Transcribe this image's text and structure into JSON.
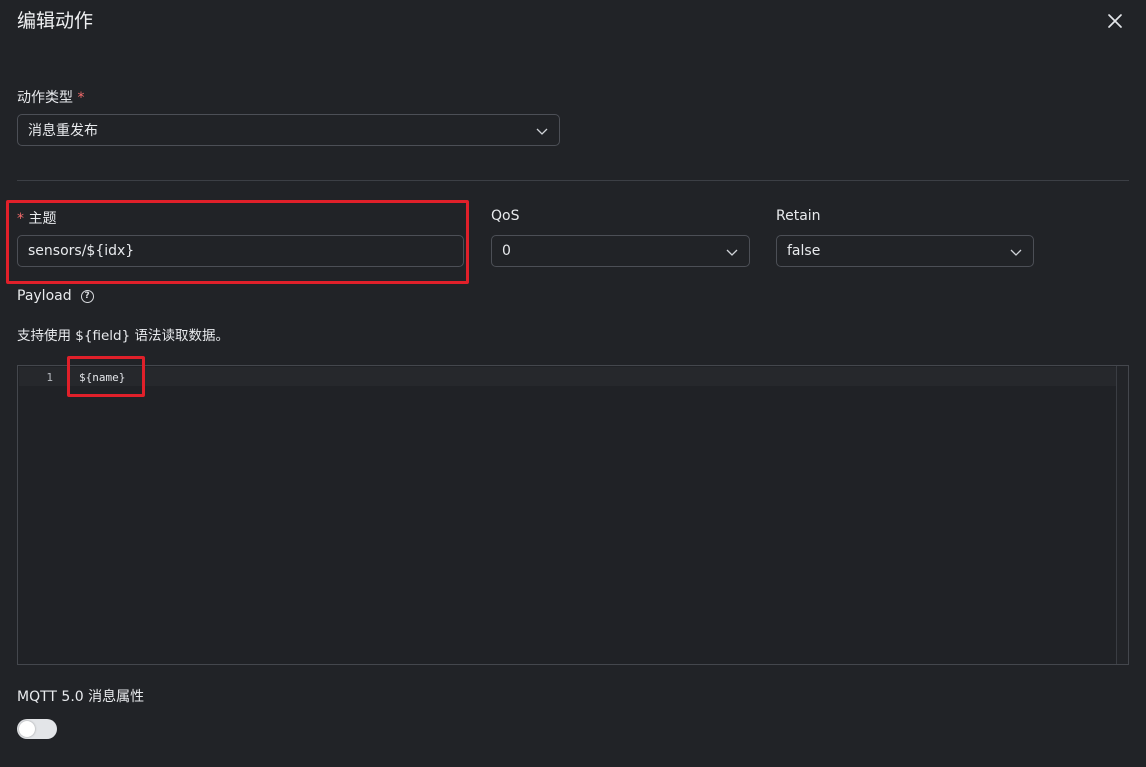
{
  "dialog": {
    "title": "编辑动作"
  },
  "action_type": {
    "label": "动作类型",
    "required_mark": "*",
    "value": "消息重发布"
  },
  "topic": {
    "required_mark": "*",
    "label": "主题",
    "value": "sensors/${idx}"
  },
  "qos": {
    "label": "QoS",
    "value": "0"
  },
  "retain": {
    "label": "Retain",
    "value": "false"
  },
  "payload": {
    "label": "Payload",
    "help_glyph": "?",
    "hint": "支持使用 ${field} 语法读取数据。",
    "editor": {
      "lines": [
        {
          "number": "1",
          "code": "${name}"
        }
      ]
    }
  },
  "mqtt5": {
    "label": "MQTT 5.0 消息属性",
    "enabled": false
  },
  "colors": {
    "background": "#212327",
    "highlight": "#e0202a",
    "required": "#f56c6c"
  }
}
